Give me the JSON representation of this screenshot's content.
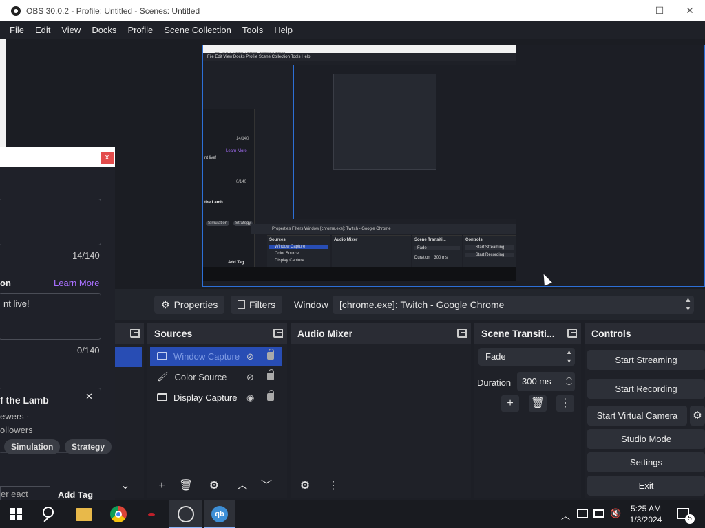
{
  "window": {
    "title": "OBS 30.0.2 - Profile: Untitled - Scenes: Untitled",
    "minimize": "—",
    "maximize": "☐",
    "close": "✕"
  },
  "menu": [
    "File",
    "Edit",
    "View",
    "Docks",
    "Profile",
    "Scene Collection",
    "Tools",
    "Help"
  ],
  "preview": {
    "nested_title": "OBS 30.0.2 - Profile: Untitled - Scenes: Untitled",
    "nested_menu": "File   Edit   View   Docks   Profile   Scene Collection   Tools   Help",
    "nested_toolbar": "Properties    Filters    Window    [chrome.exe]: Twitch - Google Chrome",
    "nested_panels": {
      "sources": "Sources",
      "source_items": [
        "Window Capture",
        "Color Source",
        "Display Capture"
      ],
      "audio": "Audio Mixer",
      "transitions": "Scene Transiti...",
      "fade": "Fade",
      "duration": "Duration",
      "duration_value": "300 ms",
      "controls": "Controls",
      "control_items": [
        "Start Streaming",
        "Start Recording",
        "Start Virtual Camera",
        "Studio Mode",
        "Settings",
        "Exit"
      ]
    },
    "nested_chat": {
      "count1": "14/140",
      "learn": "Learn More",
      "text": "nt live!",
      "count2": "0/140",
      "game": "the Lamb",
      "tags": [
        "Simulation",
        "Strategy"
      ],
      "addtag": "Add Tag"
    }
  },
  "chat_overlay": {
    "close": "x",
    "title_count": "14/140",
    "section_label": "on",
    "learn_more": "Learn More",
    "notification_text": "nt live!",
    "notification_count": "0/140",
    "game_title": "f the Lamb",
    "viewers": "ewers  ·",
    "followers": "ollowers",
    "tags": [
      "Simulation",
      "Strategy"
    ],
    "tag_input_placeholder": "er eact",
    "add_tag": "Add Tag",
    "close_card": "✕"
  },
  "toolbar": {
    "properties": "Properties",
    "filters": "Filters",
    "window_label": "Window",
    "window_value": "[chrome.exe]: Twitch - Google Chrome"
  },
  "docks": {
    "sources": {
      "title": "Sources",
      "items": [
        {
          "label": "Window Capture",
          "selected": true,
          "visible": false
        },
        {
          "label": "Color Source",
          "selected": false,
          "visible": false
        },
        {
          "label": "Display Capture",
          "selected": false,
          "visible": true
        }
      ]
    },
    "audio": {
      "title": "Audio Mixer"
    },
    "transitions": {
      "title": "Scene Transiti...",
      "type": "Fade",
      "duration_label": "Duration",
      "duration_value": "300 ms"
    },
    "controls": {
      "title": "Controls",
      "buttons": [
        "Start Streaming",
        "Start Recording",
        "Start Virtual Camera",
        "Studio Mode",
        "Settings",
        "Exit"
      ]
    }
  },
  "taskbar": {
    "time": "5:25 AM",
    "date": "1/3/2024",
    "notifications": "5"
  },
  "colors": {
    "accent": "#284db4",
    "panel": "#2a2c34",
    "background": "#1f2128"
  }
}
